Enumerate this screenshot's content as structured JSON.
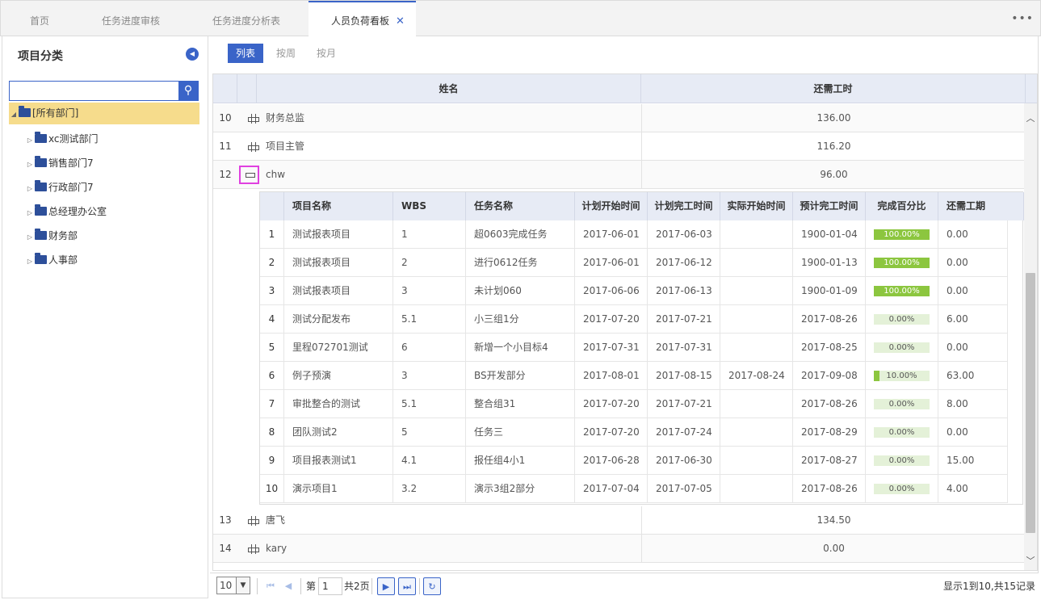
{
  "tabs": [
    {
      "label": "首页"
    },
    {
      "label": "任务进度审核"
    },
    {
      "label": "任务进度分析表"
    },
    {
      "label": "人员负荷看板",
      "active": true
    }
  ],
  "more_icon": "more-icon",
  "sidebar": {
    "title": "项目分类",
    "search_placeholder": "",
    "root": "[所有部门]",
    "items": [
      {
        "label": "xc测试部门"
      },
      {
        "label": "销售部门7"
      },
      {
        "label": "行政部门7"
      },
      {
        "label": "总经理办公室"
      },
      {
        "label": "财务部"
      },
      {
        "label": "人事部"
      }
    ]
  },
  "view_tabs": [
    {
      "label": "列表",
      "active": true
    },
    {
      "label": "按周"
    },
    {
      "label": "按月"
    }
  ],
  "grid": {
    "headers": {
      "name": "姓名",
      "hours": "还需工时"
    },
    "rows_top": [
      {
        "num": "10",
        "name": "财务总监",
        "hours": "136.00"
      },
      {
        "num": "11",
        "name": "项目主管",
        "hours": "116.20"
      },
      {
        "num": "12",
        "name": "chw",
        "hours": "96.00",
        "expanded": true
      }
    ],
    "rows_bottom": [
      {
        "num": "13",
        "name": "唐飞",
        "hours": "134.50"
      },
      {
        "num": "14",
        "name": "kary",
        "hours": "0.00"
      }
    ]
  },
  "detail": {
    "headers": {
      "project": "项目名称",
      "wbs": "WBS",
      "task": "任务名称",
      "plan_start": "计划开始时间",
      "plan_end": "计划完工时间",
      "actual_start": "实际开始时间",
      "est_end": "预计完工时间",
      "percent": "完成百分比",
      "remaining": "还需工期"
    },
    "rows": [
      {
        "n": "1",
        "project": "测试报表项目",
        "wbs": "1",
        "task": "超0603完成任务",
        "plan_start": "2017-06-01",
        "plan_end": "2017-06-03",
        "actual_start": "",
        "est_end": "1900-01-04",
        "percent": "100.00%",
        "pct": 100,
        "remaining": "0.00"
      },
      {
        "n": "2",
        "project": "测试报表项目",
        "wbs": "2",
        "task": "进行0612任务",
        "plan_start": "2017-06-01",
        "plan_end": "2017-06-12",
        "actual_start": "",
        "est_end": "1900-01-13",
        "percent": "100.00%",
        "pct": 100,
        "remaining": "0.00"
      },
      {
        "n": "3",
        "project": "测试报表项目",
        "wbs": "3",
        "task": "未计划060",
        "plan_start": "2017-06-06",
        "plan_end": "2017-06-13",
        "actual_start": "",
        "est_end": "1900-01-09",
        "percent": "100.00%",
        "pct": 100,
        "remaining": "0.00"
      },
      {
        "n": "4",
        "project": "测试分配发布",
        "wbs": "5.1",
        "task": "小三组1分",
        "plan_start": "2017-07-20",
        "plan_end": "2017-07-21",
        "actual_start": "",
        "est_end": "2017-08-26",
        "percent": "0.00%",
        "pct": 0,
        "remaining": "6.00"
      },
      {
        "n": "5",
        "project": "里程072701测试",
        "wbs": "6",
        "task": "新增一个小目标4",
        "plan_start": "2017-07-31",
        "plan_end": "2017-07-31",
        "actual_start": "",
        "est_end": "2017-08-25",
        "percent": "0.00%",
        "pct": 0,
        "remaining": "0.00"
      },
      {
        "n": "6",
        "project": "例子预演",
        "wbs": "3",
        "task": "BS开发部分",
        "plan_start": "2017-08-01",
        "plan_end": "2017-08-15",
        "actual_start": "2017-08-24",
        "est_end": "2017-09-08",
        "percent": "10.00%",
        "pct": 10,
        "remaining": "63.00"
      },
      {
        "n": "7",
        "project": "审批整合的测试",
        "wbs": "5.1",
        "task": "整合组31",
        "plan_start": "2017-07-20",
        "plan_end": "2017-07-21",
        "actual_start": "",
        "est_end": "2017-08-26",
        "percent": "0.00%",
        "pct": 0,
        "remaining": "8.00"
      },
      {
        "n": "8",
        "project": "团队测试2",
        "wbs": "5",
        "task": "任务三",
        "plan_start": "2017-07-20",
        "plan_end": "2017-07-24",
        "actual_start": "",
        "est_end": "2017-08-29",
        "percent": "0.00%",
        "pct": 0,
        "remaining": "0.00"
      },
      {
        "n": "9",
        "project": "项目报表测试1",
        "wbs": "4.1",
        "task": "报任组4小1",
        "plan_start": "2017-06-28",
        "plan_end": "2017-06-30",
        "actual_start": "",
        "est_end": "2017-08-27",
        "percent": "0.00%",
        "pct": 0,
        "remaining": "15.00"
      },
      {
        "n": "10",
        "project": "演示项目1",
        "wbs": "3.2",
        "task": "演示3组2部分",
        "plan_start": "2017-07-04",
        "plan_end": "2017-07-05",
        "actual_start": "",
        "est_end": "2017-08-26",
        "percent": "0.00%",
        "pct": 0,
        "remaining": "4.00"
      }
    ]
  },
  "pager": {
    "page_size": "10",
    "page_prefix": "第",
    "page": "1",
    "total_pages": "共2页",
    "info": "显示1到10,共15记录"
  },
  "colors": {
    "accent": "#3a64c8",
    "selected_row": "#f6dc8c",
    "progress": "#8cc63f",
    "highlight": "#e040e0"
  }
}
